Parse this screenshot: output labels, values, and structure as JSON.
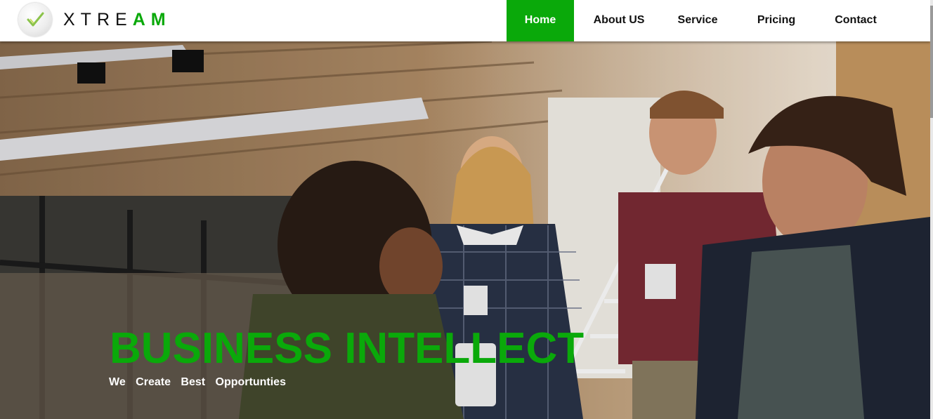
{
  "brand": {
    "part1": "XTRE",
    "part2": "AM",
    "logo_icon": "checkmark-icon",
    "accent_color": "#0aa90a"
  },
  "nav": {
    "items": [
      {
        "label": "Home",
        "active": true
      },
      {
        "label": "About US",
        "active": false
      },
      {
        "label": "Service",
        "active": false
      },
      {
        "label": "Pricing",
        "active": false
      },
      {
        "label": "Contact",
        "active": false
      }
    ]
  },
  "hero": {
    "title": "BUSINESS INTELLECT",
    "subtitle": "We Create Best Opportunties",
    "image": "office-team-meeting-photo"
  }
}
